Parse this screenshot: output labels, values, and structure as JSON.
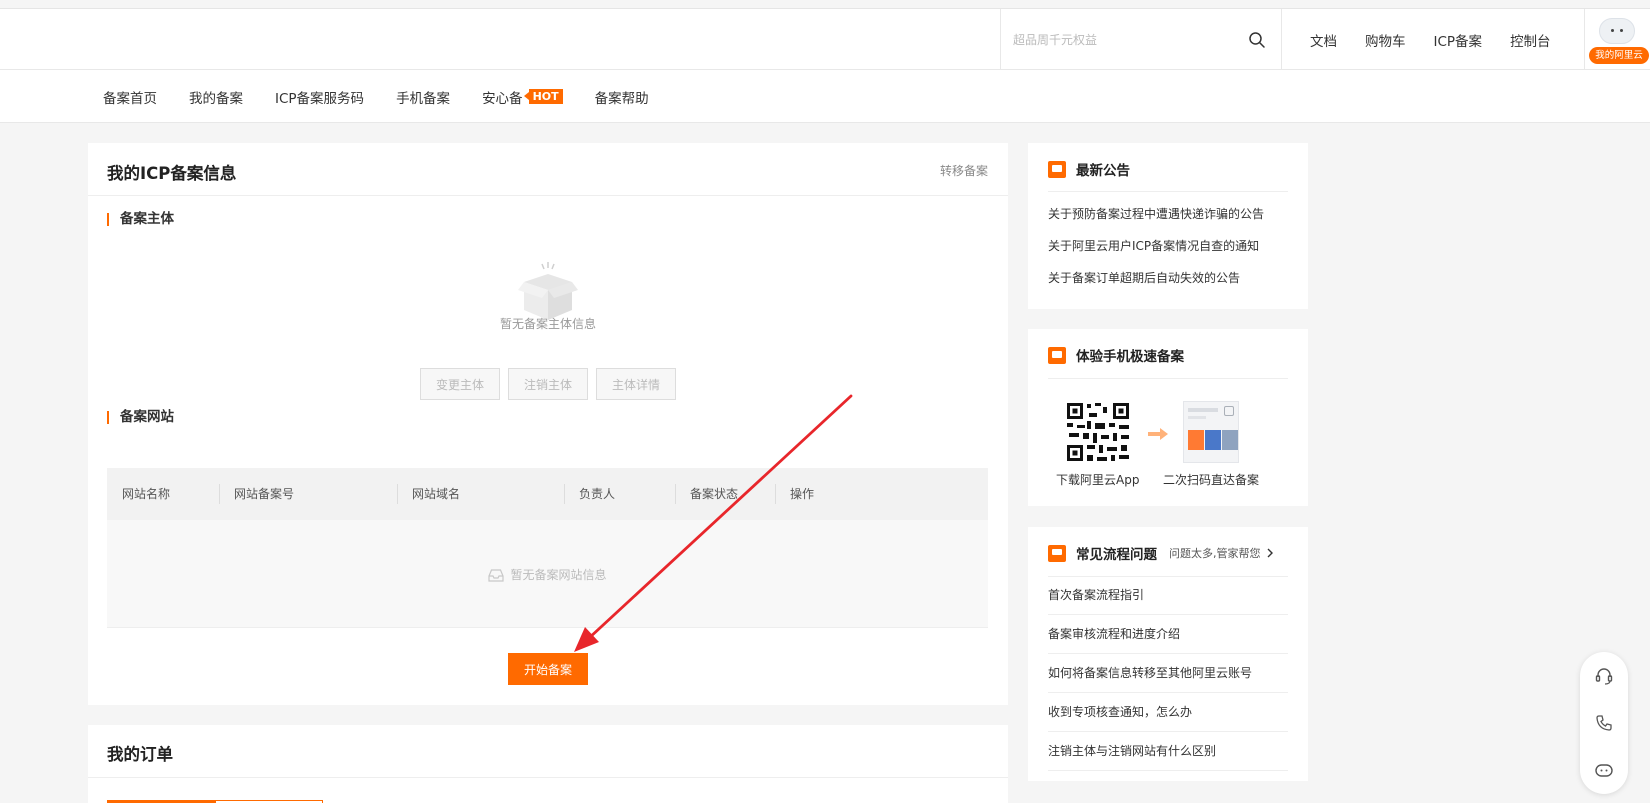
{
  "header": {
    "search_placeholder": "超品周千元权益",
    "nav": [
      "文档",
      "购物车",
      "ICP备案",
      "控制台"
    ],
    "user_badge": "我的阿里云"
  },
  "subnav": {
    "items": [
      "备案首页",
      "我的备案",
      "ICP备案服务码",
      "手机备案",
      "安心备",
      "备案帮助"
    ],
    "hot_badge": "HOT"
  },
  "main": {
    "title": "我的ICP备案信息",
    "transfer_link": "转移备案",
    "subject_section": "备案主体",
    "subject_empty": "暂无备案主体信息",
    "subject_buttons": [
      "变更主体",
      "注销主体",
      "主体详情"
    ],
    "website_section": "备案网站",
    "table_columns": [
      "网站名称",
      "网站备案号",
      "网站域名",
      "负责人",
      "备案状态",
      "操作"
    ],
    "table_empty": "暂无备案网站信息",
    "start_button": "开始备案"
  },
  "orders": {
    "title": "我的订单"
  },
  "announcements": {
    "title": "最新公告",
    "items": [
      "关于预防备案过程中遭遇快递诈骗的公告",
      "关于阿里云用户ICP备案情况自查的通知",
      "关于备案订单超期后自动失效的公告"
    ]
  },
  "mobile": {
    "title": "体验手机极速备案",
    "qr_caption": "下载阿里云App",
    "scan_caption": "二次扫码直达备案"
  },
  "faq": {
    "title": "常见流程问题",
    "subtitle": "问题太多,管家帮您",
    "items": [
      "首次备案流程指引",
      "备案审核流程和进度介绍",
      "如何将备案信息转移至其他阿里云账号",
      "收到专项核查通知，怎么办",
      "注销主体与注销网站有什么区别"
    ]
  },
  "colors": {
    "accent": "#ff6a00",
    "annotation_arrow": "#e8262b"
  },
  "icons": {
    "search": "search-icon",
    "support": "headset-icon",
    "phone": "phone-icon",
    "assistant": "robot-icon"
  }
}
